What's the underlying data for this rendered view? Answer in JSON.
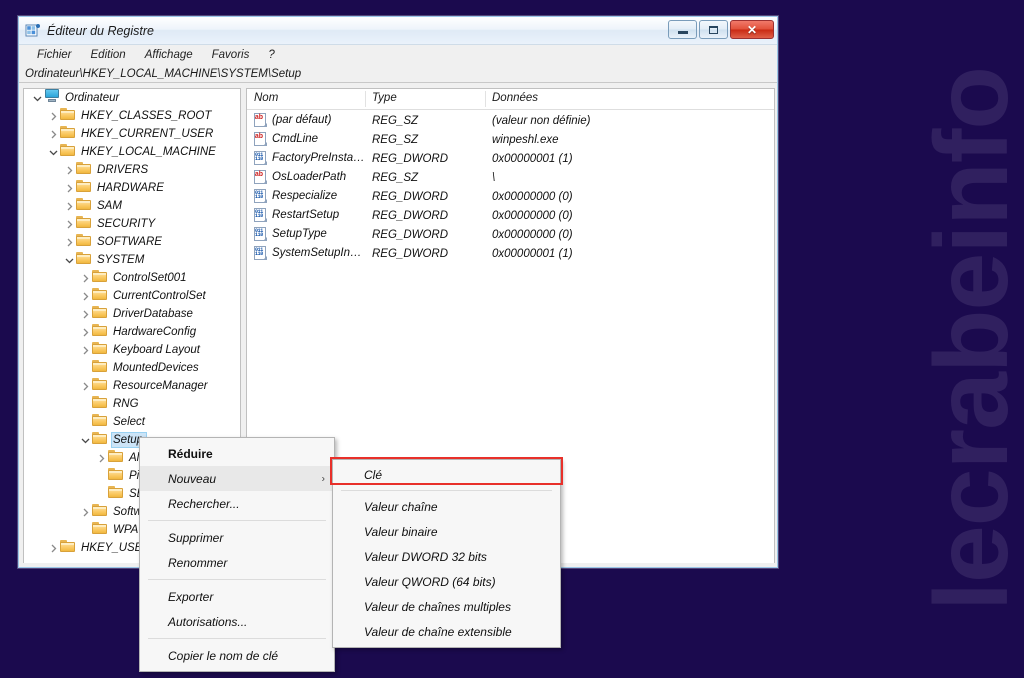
{
  "watermark": {
    "text": "lecrabeinfo"
  },
  "window": {
    "title": "Éditeur du Registre",
    "icon": "registry-editor-icon",
    "buttons": {
      "minimize": "minimize-button",
      "maximize": "maximize-button",
      "close": "close-button",
      "close_glyph": "✕"
    },
    "menubar": [
      "Fichier",
      "Edition",
      "Affichage",
      "Favoris",
      "?"
    ],
    "address": "Ordinateur\\HKEY_LOCAL_MACHINE\\SYSTEM\\Setup"
  },
  "tree": [
    {
      "label": "Ordinateur",
      "depth": 0,
      "twisty": "down",
      "icon": "computer-icon",
      "selected": false
    },
    {
      "label": "HKEY_CLASSES_ROOT",
      "depth": 1,
      "twisty": "right",
      "icon": "folder-icon",
      "selected": false
    },
    {
      "label": "HKEY_CURRENT_USER",
      "depth": 1,
      "twisty": "right",
      "icon": "folder-icon",
      "selected": false
    },
    {
      "label": "HKEY_LOCAL_MACHINE",
      "depth": 1,
      "twisty": "down",
      "icon": "folder-icon",
      "selected": false
    },
    {
      "label": "DRIVERS",
      "depth": 2,
      "twisty": "right",
      "icon": "folder-icon",
      "selected": false
    },
    {
      "label": "HARDWARE",
      "depth": 2,
      "twisty": "right",
      "icon": "folder-icon",
      "selected": false
    },
    {
      "label": "SAM",
      "depth": 2,
      "twisty": "right",
      "icon": "folder-icon",
      "selected": false
    },
    {
      "label": "SECURITY",
      "depth": 2,
      "twisty": "right",
      "icon": "folder-icon",
      "selected": false
    },
    {
      "label": "SOFTWARE",
      "depth": 2,
      "twisty": "right",
      "icon": "folder-icon",
      "selected": false
    },
    {
      "label": "SYSTEM",
      "depth": 2,
      "twisty": "down",
      "icon": "folder-icon",
      "selected": false
    },
    {
      "label": "ControlSet001",
      "depth": 3,
      "twisty": "right",
      "icon": "folder-icon",
      "selected": false
    },
    {
      "label": "CurrentControlSet",
      "depth": 3,
      "twisty": "right",
      "icon": "folder-icon",
      "selected": false
    },
    {
      "label": "DriverDatabase",
      "depth": 3,
      "twisty": "right",
      "icon": "folder-icon",
      "selected": false
    },
    {
      "label": "HardwareConfig",
      "depth": 3,
      "twisty": "right",
      "icon": "folder-icon",
      "selected": false
    },
    {
      "label": "Keyboard Layout",
      "depth": 3,
      "twisty": "right",
      "icon": "folder-icon",
      "selected": false
    },
    {
      "label": "MountedDevices",
      "depth": 3,
      "twisty": "none",
      "icon": "folder-icon",
      "selected": false
    },
    {
      "label": "ResourceManager",
      "depth": 3,
      "twisty": "right",
      "icon": "folder-icon",
      "selected": false
    },
    {
      "label": "RNG",
      "depth": 3,
      "twisty": "none",
      "icon": "folder-icon",
      "selected": false
    },
    {
      "label": "Select",
      "depth": 3,
      "twisty": "none",
      "icon": "folder-icon",
      "selected": false
    },
    {
      "label": "Setup",
      "depth": 3,
      "twisty": "down",
      "icon": "folder-icon",
      "selected": true
    },
    {
      "label": "All",
      "depth": 4,
      "twisty": "right",
      "icon": "folder-icon",
      "selected": false
    },
    {
      "label": "Pic",
      "depth": 4,
      "twisty": "none",
      "icon": "folder-icon",
      "selected": false
    },
    {
      "label": "SET",
      "depth": 4,
      "twisty": "none",
      "icon": "folder-icon",
      "selected": false
    },
    {
      "label": "Softw",
      "depth": 3,
      "twisty": "right",
      "icon": "folder-icon",
      "selected": false
    },
    {
      "label": "WPA",
      "depth": 3,
      "twisty": "none",
      "icon": "folder-icon",
      "selected": false
    },
    {
      "label": "HKEY_USERS",
      "depth": 1,
      "twisty": "right",
      "icon": "folder-icon",
      "selected": false
    }
  ],
  "list": {
    "columns": [
      "Nom",
      "Type",
      "Données"
    ],
    "rows": [
      {
        "name": "(par défaut)",
        "type": "REG_SZ",
        "data": "(valeur non définie)",
        "icon": "string-value-icon"
      },
      {
        "name": "CmdLine",
        "type": "REG_SZ",
        "data": "winpeshl.exe",
        "icon": "string-value-icon"
      },
      {
        "name": "FactoryPreInstall...",
        "type": "REG_DWORD",
        "data": "0x00000001 (1)",
        "icon": "dword-value-icon"
      },
      {
        "name": "OsLoaderPath",
        "type": "REG_SZ",
        "data": "\\",
        "icon": "string-value-icon"
      },
      {
        "name": "Respecialize",
        "type": "REG_DWORD",
        "data": "0x00000000 (0)",
        "icon": "dword-value-icon"
      },
      {
        "name": "RestartSetup",
        "type": "REG_DWORD",
        "data": "0x00000000 (0)",
        "icon": "dword-value-icon"
      },
      {
        "name": "SetupType",
        "type": "REG_DWORD",
        "data": "0x00000000 (0)",
        "icon": "dword-value-icon"
      },
      {
        "name": "SystemSetupInP...",
        "type": "REG_DWORD",
        "data": "0x00000001 (1)",
        "icon": "dword-value-icon"
      }
    ]
  },
  "context_menu": {
    "items": [
      {
        "label": "Réduire",
        "kind": "item",
        "bold": true,
        "hover": false,
        "submenu": false
      },
      {
        "label": "Nouveau",
        "kind": "item",
        "bold": false,
        "hover": true,
        "submenu": true,
        "arrow": "›"
      },
      {
        "label": "Rechercher...",
        "kind": "item",
        "bold": false,
        "hover": false,
        "submenu": false
      },
      {
        "label": "",
        "kind": "separator"
      },
      {
        "label": "Supprimer",
        "kind": "item",
        "bold": false,
        "hover": false,
        "submenu": false
      },
      {
        "label": "Renommer",
        "kind": "item",
        "bold": false,
        "hover": false,
        "submenu": false
      },
      {
        "label": "",
        "kind": "separator"
      },
      {
        "label": "Exporter",
        "kind": "item",
        "bold": false,
        "hover": false,
        "submenu": false
      },
      {
        "label": "Autorisations...",
        "kind": "item",
        "bold": false,
        "hover": false,
        "submenu": false
      },
      {
        "label": "",
        "kind": "separator"
      },
      {
        "label": "Copier le nom de clé",
        "kind": "item",
        "bold": false,
        "hover": false,
        "submenu": false
      }
    ]
  },
  "submenu": {
    "items": [
      {
        "label": "Clé",
        "kind": "item"
      },
      {
        "label": "",
        "kind": "separator"
      },
      {
        "label": "Valeur chaîne",
        "kind": "item"
      },
      {
        "label": "Valeur binaire",
        "kind": "item"
      },
      {
        "label": "Valeur DWORD 32 bits",
        "kind": "item"
      },
      {
        "label": "Valeur QWORD (64 bits)",
        "kind": "item"
      },
      {
        "label": "Valeur de chaînes multiples",
        "kind": "item"
      },
      {
        "label": "Valeur de chaîne extensible",
        "kind": "item"
      }
    ],
    "highlight_index": 0
  },
  "colors": {
    "background": "#1b0a4e",
    "watermark": "#30205f",
    "selection": "#cce4f7",
    "highlight_box": "#e8302a",
    "close_button": "#d8442c"
  }
}
